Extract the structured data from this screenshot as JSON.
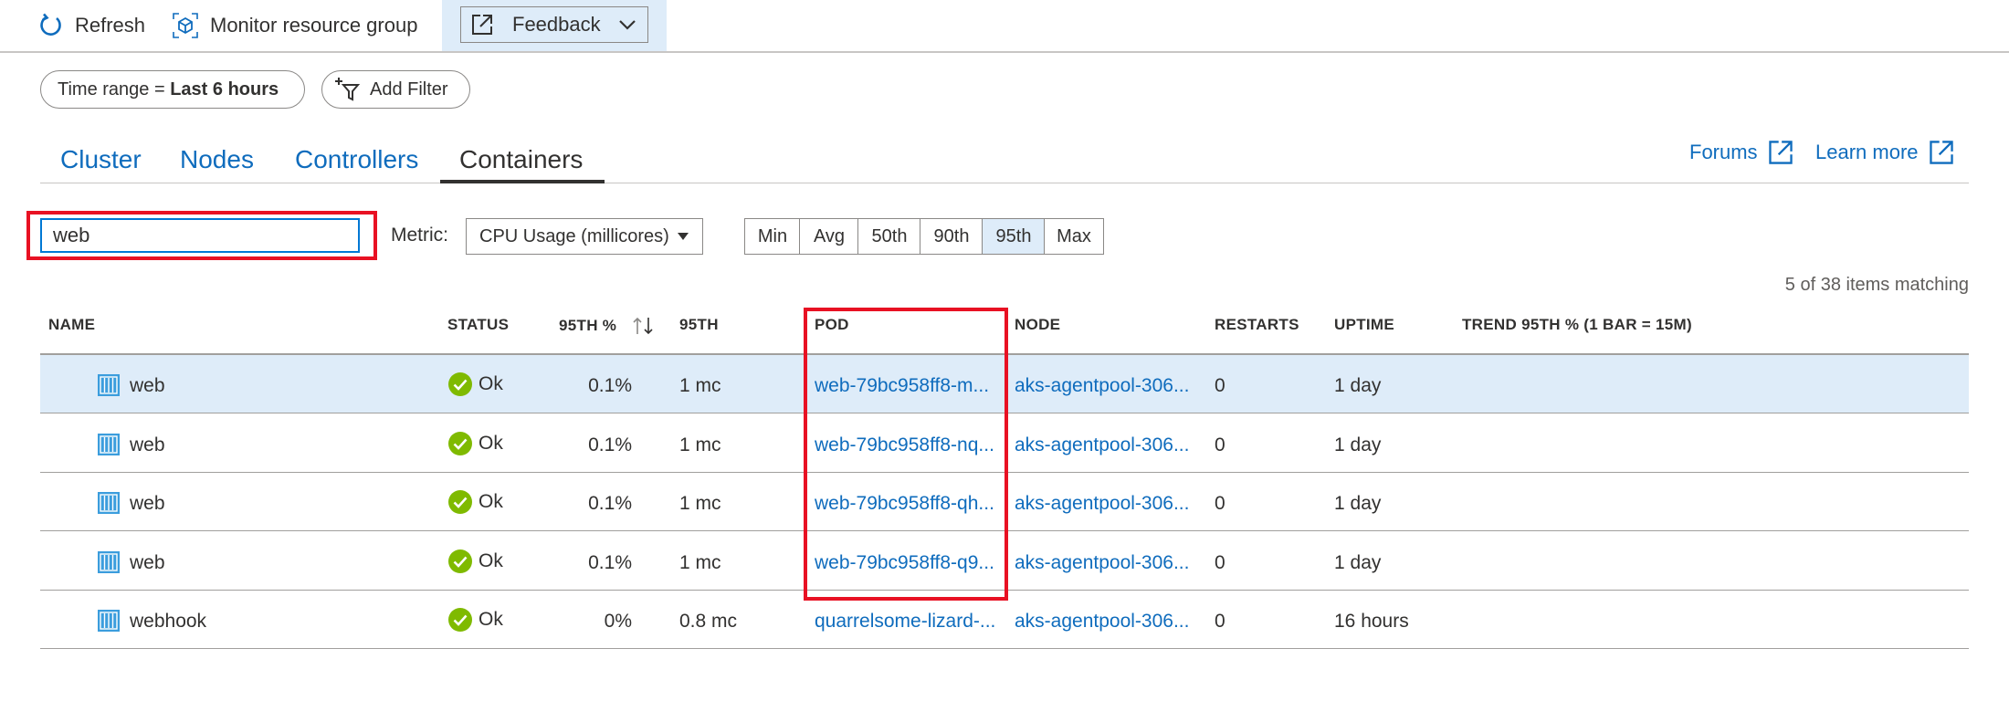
{
  "toolbar": {
    "refresh_label": "Refresh",
    "monitor_label": "Monitor resource group",
    "feedback_label": "Feedback"
  },
  "filters": {
    "time_range_prefix": "Time range = ",
    "time_range_value": "Last 6 hours",
    "add_filter_label": "Add Filter"
  },
  "tabs": [
    {
      "label": "Cluster"
    },
    {
      "label": "Nodes"
    },
    {
      "label": "Controllers"
    },
    {
      "label": "Containers",
      "active": true
    }
  ],
  "links": {
    "forums": "Forums",
    "learn_more": "Learn more"
  },
  "search": {
    "value": "web"
  },
  "metric": {
    "label": "Metric:",
    "selected": "CPU Usage (millicores)"
  },
  "aggregations": [
    "Min",
    "Avg",
    "50th",
    "90th",
    "95th",
    "Max"
  ],
  "selected_aggregation": "95th",
  "matching_text": "5 of 38 items matching",
  "columns": {
    "name": "NAME",
    "status": "STATUS",
    "pct": "95TH %",
    "val": "95TH",
    "pod": "POD",
    "node": "NODE",
    "restarts": "RESTARTS",
    "uptime": "UPTIME",
    "trend": "TREND 95TH % (1 BAR = 15M)"
  },
  "rows": [
    {
      "name": "web",
      "status": "Ok",
      "pct": "0.1%",
      "val": "1 mc",
      "pod": "web-79bc958ff8-m...",
      "node": "aks-agentpool-306...",
      "restarts": "0",
      "uptime": "1 day"
    },
    {
      "name": "web",
      "status": "Ok",
      "pct": "0.1%",
      "val": "1 mc",
      "pod": "web-79bc958ff8-nq...",
      "node": "aks-agentpool-306...",
      "restarts": "0",
      "uptime": "1 day"
    },
    {
      "name": "web",
      "status": "Ok",
      "pct": "0.1%",
      "val": "1 mc",
      "pod": "web-79bc958ff8-qh...",
      "node": "aks-agentpool-306...",
      "restarts": "0",
      "uptime": "1 day"
    },
    {
      "name": "web",
      "status": "Ok",
      "pct": "0.1%",
      "val": "1 mc",
      "pod": "web-79bc958ff8-q9...",
      "node": "aks-agentpool-306...",
      "restarts": "0",
      "uptime": "1 day"
    },
    {
      "name": "webhook",
      "status": "Ok",
      "pct": "0%",
      "val": "0.8 mc",
      "pod": "quarrelsome-lizard-...",
      "node": "aks-agentpool-306...",
      "restarts": "0",
      "uptime": "16 hours"
    }
  ],
  "colors": {
    "accent": "#0f6cbd",
    "selection": "#deecf9",
    "ok_green": "#7fba00",
    "highlight_red": "#e81123",
    "container_icon": "#3b9ddd"
  }
}
